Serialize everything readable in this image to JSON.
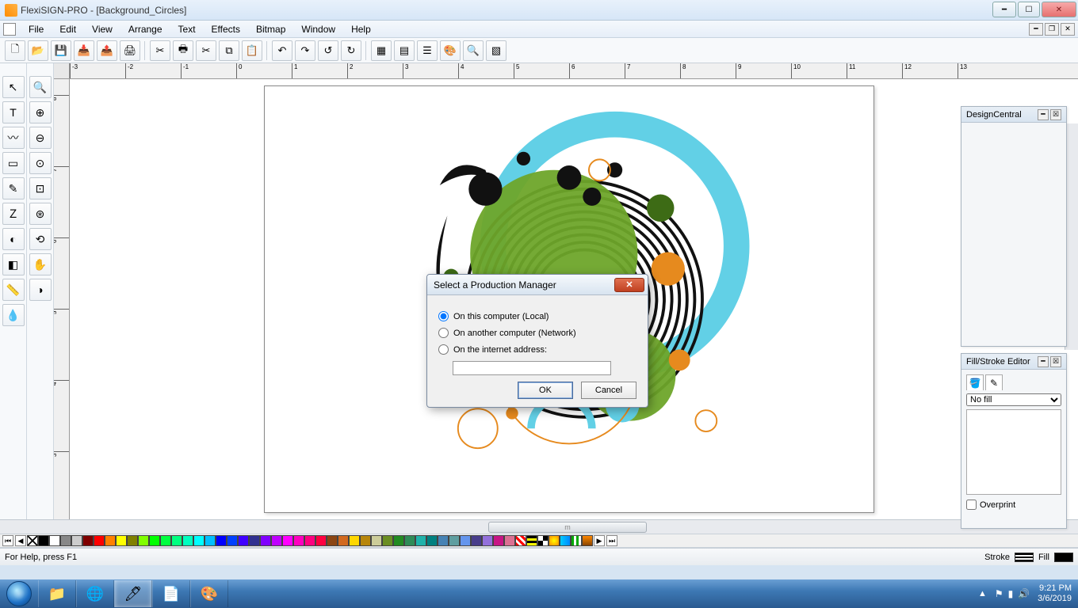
{
  "title": "FlexiSIGN-PRO - [Background_Circles]",
  "menu": [
    "File",
    "Edit",
    "View",
    "Arrange",
    "Text",
    "Effects",
    "Bitmap",
    "Window",
    "Help"
  ],
  "toolbar_icons": [
    "new-icon",
    "open-icon",
    "save-icon",
    "import-icon",
    "export-icon",
    "print-icon",
    "cut-plot-icon",
    "rip-icon",
    "cut-icon",
    "copy-icon",
    "paste-icon",
    "undo-icon",
    "redo-icon",
    "undo2-icon",
    "redo2-icon",
    "designcentral-icon",
    "filleditor-icon",
    "layers-icon",
    "colormixer-icon",
    "zoom-icon",
    "swatch-icon"
  ],
  "left_tools1": [
    "select-icon",
    "text-icon",
    "bezier-icon",
    "rectangle-icon",
    "measure-icon",
    "effects-icon",
    "circle-icon",
    "shape-icon",
    "ruler-icon",
    "eyedropper-icon"
  ],
  "left_tools2": [
    "zoomarea-icon",
    "zoomin-icon",
    "zoomout-icon",
    "zoomfit-icon",
    "zoompage-icon",
    "zoomsel-icon",
    "zoomprev-icon",
    "pan-icon",
    "fillview-icon"
  ],
  "ruler_numbers_h": [
    "-3",
    "-2",
    "-1",
    "0",
    "1",
    "2",
    "3",
    "4",
    "5",
    "6",
    "7",
    "8",
    "9",
    "10",
    "11",
    "12",
    "13"
  ],
  "ruler_numbers_v": [
    "8",
    "7",
    "6",
    "5",
    "4",
    "3"
  ],
  "design_central": {
    "title": "DesignCentral"
  },
  "fill_stroke": {
    "title": "Fill/Stroke Editor",
    "fill_select": "No fill",
    "overprint": "Overprint"
  },
  "dialog": {
    "title": "Select a Production Manager",
    "opt_local": "On this computer (Local)",
    "opt_network": "On another computer (Network)",
    "opt_internet": "On the internet address:",
    "ok": "OK",
    "cancel": "Cancel"
  },
  "scroll_label": "m",
  "swatches": [
    "#000",
    "#fff",
    "#888",
    "#ccc",
    "#7f0000",
    "#f00",
    "#ff8000",
    "#ffff00",
    "#808000",
    "#80ff00",
    "#0f0",
    "#00ff40",
    "#00ff80",
    "#00ffbf",
    "#0ff",
    "#00bfff",
    "#00f",
    "#0040ff",
    "#4000ff",
    "#303090",
    "#8000ff",
    "#bf00ff",
    "#f0f",
    "#ff00bf",
    "#ff0080",
    "#ff0040",
    "#8b4513",
    "#d2691e",
    "#ffd700",
    "#b8860b",
    "#cc9",
    "#6b8e23",
    "#228b22",
    "#2e8b57",
    "#20b2aa",
    "#008080",
    "#4682b4",
    "#5f9ea0",
    "#6495ed",
    "#483d8b",
    "#9370db",
    "#c71585",
    "#db7093"
  ],
  "status_help": "For Help, press F1",
  "status_stroke": "Stroke",
  "status_fill": "Fill",
  "time": "9:21 PM",
  "date": "3/6/2019"
}
